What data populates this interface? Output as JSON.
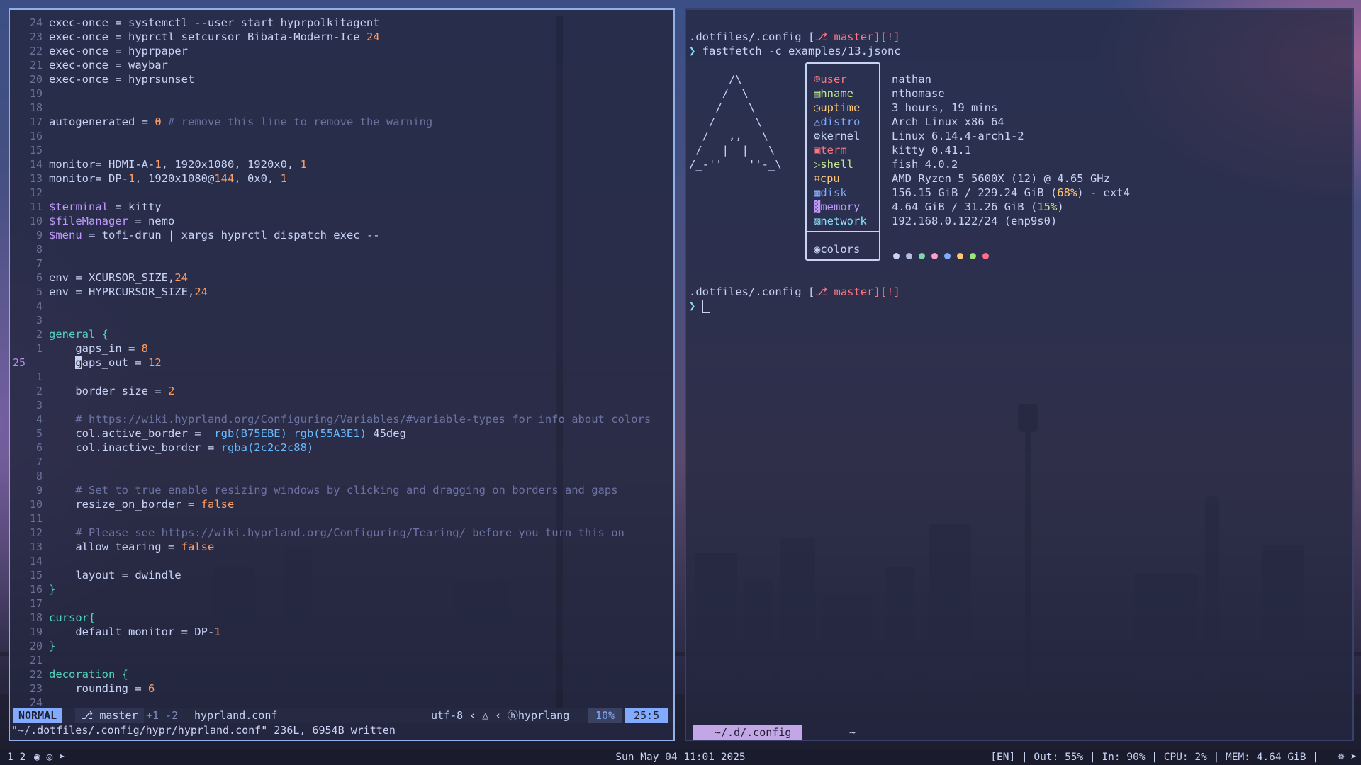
{
  "colors": {
    "accent": "#82aaff",
    "keyword": "#c8d3f5",
    "number": "#ff9e64",
    "variable": "#c099ff",
    "section": "#4fd6be",
    "comment": "#6c73a3"
  },
  "editor": {
    "lines": [
      {
        "ln": "24",
        "parts": [
          [
            "k",
            "exec-once = systemctl --user start hyprpolkitagent"
          ]
        ]
      },
      {
        "ln": "23",
        "parts": [
          [
            "k",
            "exec-once = hyprctl setcursor Bibata-Modern-Ice "
          ],
          [
            "n",
            "24"
          ]
        ]
      },
      {
        "ln": "22",
        "parts": [
          [
            "k",
            "exec-once = hyprpaper"
          ]
        ]
      },
      {
        "ln": "21",
        "parts": [
          [
            "k",
            "exec-once = waybar"
          ]
        ]
      },
      {
        "ln": "20",
        "parts": [
          [
            "k",
            "exec-once = hyprsunset"
          ]
        ]
      },
      {
        "ln": "19",
        "parts": []
      },
      {
        "ln": "18",
        "parts": []
      },
      {
        "ln": "17",
        "parts": [
          [
            "k",
            "autogenerated = "
          ],
          [
            "n",
            "0"
          ],
          [
            "c",
            " # remove this line to remove the warning"
          ]
        ]
      },
      {
        "ln": "16",
        "parts": []
      },
      {
        "ln": "15",
        "parts": []
      },
      {
        "ln": "14",
        "parts": [
          [
            "k",
            "monitor= HDMI-A-"
          ],
          [
            "n",
            "1"
          ],
          [
            "k",
            ", 1920x1080, 1920x0, "
          ],
          [
            "n",
            "1"
          ]
        ]
      },
      {
        "ln": "13",
        "parts": [
          [
            "k",
            "monitor= DP-"
          ],
          [
            "n",
            "1"
          ],
          [
            "k",
            ", 1920x1080@"
          ],
          [
            "n",
            "144"
          ],
          [
            "k",
            ", 0x0, "
          ],
          [
            "n",
            "1"
          ]
        ]
      },
      {
        "ln": "12",
        "parts": []
      },
      {
        "ln": "11",
        "parts": [
          [
            "v",
            "$terminal"
          ],
          [
            "k",
            " = kitty"
          ]
        ]
      },
      {
        "ln": "10",
        "parts": [
          [
            "v",
            "$fileManager"
          ],
          [
            "k",
            " = nemo"
          ]
        ]
      },
      {
        "ln": "9",
        "parts": [
          [
            "v",
            "$menu"
          ],
          [
            "k",
            " = tofi-drun | xargs hyprctl dispatch exec --"
          ]
        ]
      },
      {
        "ln": "8",
        "parts": []
      },
      {
        "ln": "7",
        "parts": []
      },
      {
        "ln": "6",
        "parts": [
          [
            "k",
            "env = XCURSOR_SIZE,"
          ],
          [
            "n",
            "24"
          ]
        ]
      },
      {
        "ln": "5",
        "parts": [
          [
            "k",
            "env = HYPRCURSOR_SIZE,"
          ],
          [
            "n",
            "24"
          ]
        ]
      },
      {
        "ln": "4",
        "parts": []
      },
      {
        "ln": "3",
        "parts": []
      },
      {
        "ln": "2",
        "parts": [
          [
            "g",
            "general {"
          ]
        ]
      },
      {
        "ln": "1",
        "parts": [
          [
            "k",
            "    gaps_in = "
          ],
          [
            "n",
            "8"
          ]
        ]
      },
      {
        "ln": "25",
        "cur": true,
        "parts": [
          [
            "k",
            "    "
          ],
          [
            "cur",
            "g"
          ],
          [
            "k",
            "aps_out = "
          ],
          [
            "n",
            "12"
          ]
        ]
      },
      {
        "ln": "1",
        "parts": []
      },
      {
        "ln": "2",
        "parts": [
          [
            "k",
            "    border_size = "
          ],
          [
            "n",
            "2"
          ]
        ]
      },
      {
        "ln": "3",
        "parts": []
      },
      {
        "ln": "4",
        "parts": [
          [
            "c",
            "    # https://wiki.hyprland.org/Configuring/Variables/#variable-types for info about colors"
          ]
        ]
      },
      {
        "ln": "5",
        "parts": [
          [
            "k",
            "    col.active_border =  "
          ],
          [
            "f",
            "rgb(B75EBE) rgb(55A3E1)"
          ],
          [
            "k",
            " 45deg"
          ]
        ]
      },
      {
        "ln": "6",
        "parts": [
          [
            "k",
            "    col.inactive_border = "
          ],
          [
            "f",
            "rgba(2c2c2c88)"
          ]
        ]
      },
      {
        "ln": "7",
        "parts": []
      },
      {
        "ln": "8",
        "parts": []
      },
      {
        "ln": "9",
        "parts": [
          [
            "c",
            "    # Set to true enable resizing windows by clicking and dragging on borders and gaps"
          ]
        ]
      },
      {
        "ln": "10",
        "parts": [
          [
            "k",
            "    resize_on_border = "
          ],
          [
            "b",
            "false"
          ]
        ]
      },
      {
        "ln": "11",
        "parts": []
      },
      {
        "ln": "12",
        "parts": [
          [
            "c",
            "    # Please see https://wiki.hyprland.org/Configuring/Tearing/ before you turn this on"
          ]
        ]
      },
      {
        "ln": "13",
        "parts": [
          [
            "k",
            "    allow_tearing = "
          ],
          [
            "b",
            "false"
          ]
        ]
      },
      {
        "ln": "14",
        "parts": []
      },
      {
        "ln": "15",
        "parts": [
          [
            "k",
            "    layout = dwindle"
          ]
        ]
      },
      {
        "ln": "16",
        "parts": [
          [
            "g",
            "}"
          ]
        ]
      },
      {
        "ln": "17",
        "parts": []
      },
      {
        "ln": "18",
        "parts": [
          [
            "g",
            "cursor{"
          ]
        ]
      },
      {
        "ln": "19",
        "parts": [
          [
            "k",
            "    default_monitor = DP-"
          ],
          [
            "n",
            "1"
          ]
        ]
      },
      {
        "ln": "20",
        "parts": [
          [
            "g",
            "}"
          ]
        ]
      },
      {
        "ln": "21",
        "parts": []
      },
      {
        "ln": "22",
        "parts": [
          [
            "g",
            "decoration {"
          ]
        ]
      },
      {
        "ln": "23",
        "parts": [
          [
            "k",
            "    rounding = "
          ],
          [
            "n",
            "6"
          ]
        ]
      },
      {
        "ln": "24",
        "parts": []
      }
    ],
    "status": {
      "mode": "NORMAL",
      "branch": "⎇ master",
      "diff": "+1 -2",
      "filename": "hyprland.conf",
      "encoding": "utf-8 ‹ △ ‹",
      "filetype": "ⓗhyprlang",
      "percent": "10%",
      "position": "25:5"
    },
    "cmdline": "\"~/.dotfiles/.config/hypr/hyprland.conf\" 236L, 6954B written"
  },
  "terminal": {
    "prompt1_path": ".dotfiles/.config [",
    "prompt1_branch": "⎇ master",
    "prompt1_end": "][!]",
    "command_prefix": "❯ ",
    "command": "fastfetch -c examples/13.jsonc",
    "art": [
      "      /\\",
      "     /  \\",
      "    /    \\",
      "   /      \\",
      "  /   ,,   \\",
      " /   |  |   \\",
      "/_-''    ''-_\\"
    ],
    "fetch": [
      {
        "icon": "☺",
        "key": "user",
        "color": "#ff757f",
        "value": "nathan"
      },
      {
        "icon": "▤",
        "key": "hname",
        "color": "#c3e88d",
        "value": "nthomase"
      },
      {
        "icon": "◷",
        "key": "uptime",
        "color": "#ffc777",
        "value": "3 hours, 19 mins"
      },
      {
        "icon": "△",
        "key": "distro",
        "color": "#82aaff",
        "value": "Arch Linux x86_64"
      },
      {
        "icon": "⚙",
        "key": "kernel",
        "color": "#c8d3f5",
        "value": "Linux 6.14.4-arch1-2"
      },
      {
        "icon": "▣",
        "key": "term",
        "color": "#ff757f",
        "value": "kitty 0.41.1"
      },
      {
        "icon": "▷",
        "key": "shell",
        "color": "#c3e88d",
        "value": "fish 4.0.2"
      },
      {
        "icon": "⌗",
        "key": "cpu",
        "color": "#ffc777",
        "value": "AMD Ryzen 5 5600X (12) @ 4.65 GHz"
      },
      {
        "icon": "▦",
        "key": "disk",
        "color": "#82aaff",
        "value_pre": "156.15 GiB / 229.24 GiB (",
        "value_hi": "68%",
        "value_post": ") - ext4"
      },
      {
        "icon": "▓",
        "key": "memory",
        "color": "#c099ff",
        "value_pre": "4.64 GiB / 31.26 GiB (",
        "value_hi": "15%",
        "value_post": ")",
        "hi_color": "#c3e88d"
      },
      {
        "icon": "▨",
        "key": "network",
        "color": "#86e1fc",
        "value": "192.168.0.122/24 (enp9s0)"
      }
    ],
    "colors_label": "colors",
    "palette": [
      "#c8d3f5",
      "#b4bde0",
      "#7fd6a8",
      "#ff9ecb",
      "#82aaff",
      "#ffc777",
      "#9ce57a",
      "#ff6f8c"
    ],
    "prompt2_path": ".dotfiles/.config [",
    "prompt2_branch": "⎇ master",
    "prompt2_end": "][!]",
    "tab_active": "~/.d/.config",
    "tab_other": "~"
  },
  "bar": {
    "workspaces": "1  2",
    "clock": "Sun May 04 11:01 2025",
    "system": "[EN] | Out: 55% | In: 90% | CPU: 2% | MEM: 4.64 GiB |",
    "tray": "☸ ➤"
  }
}
